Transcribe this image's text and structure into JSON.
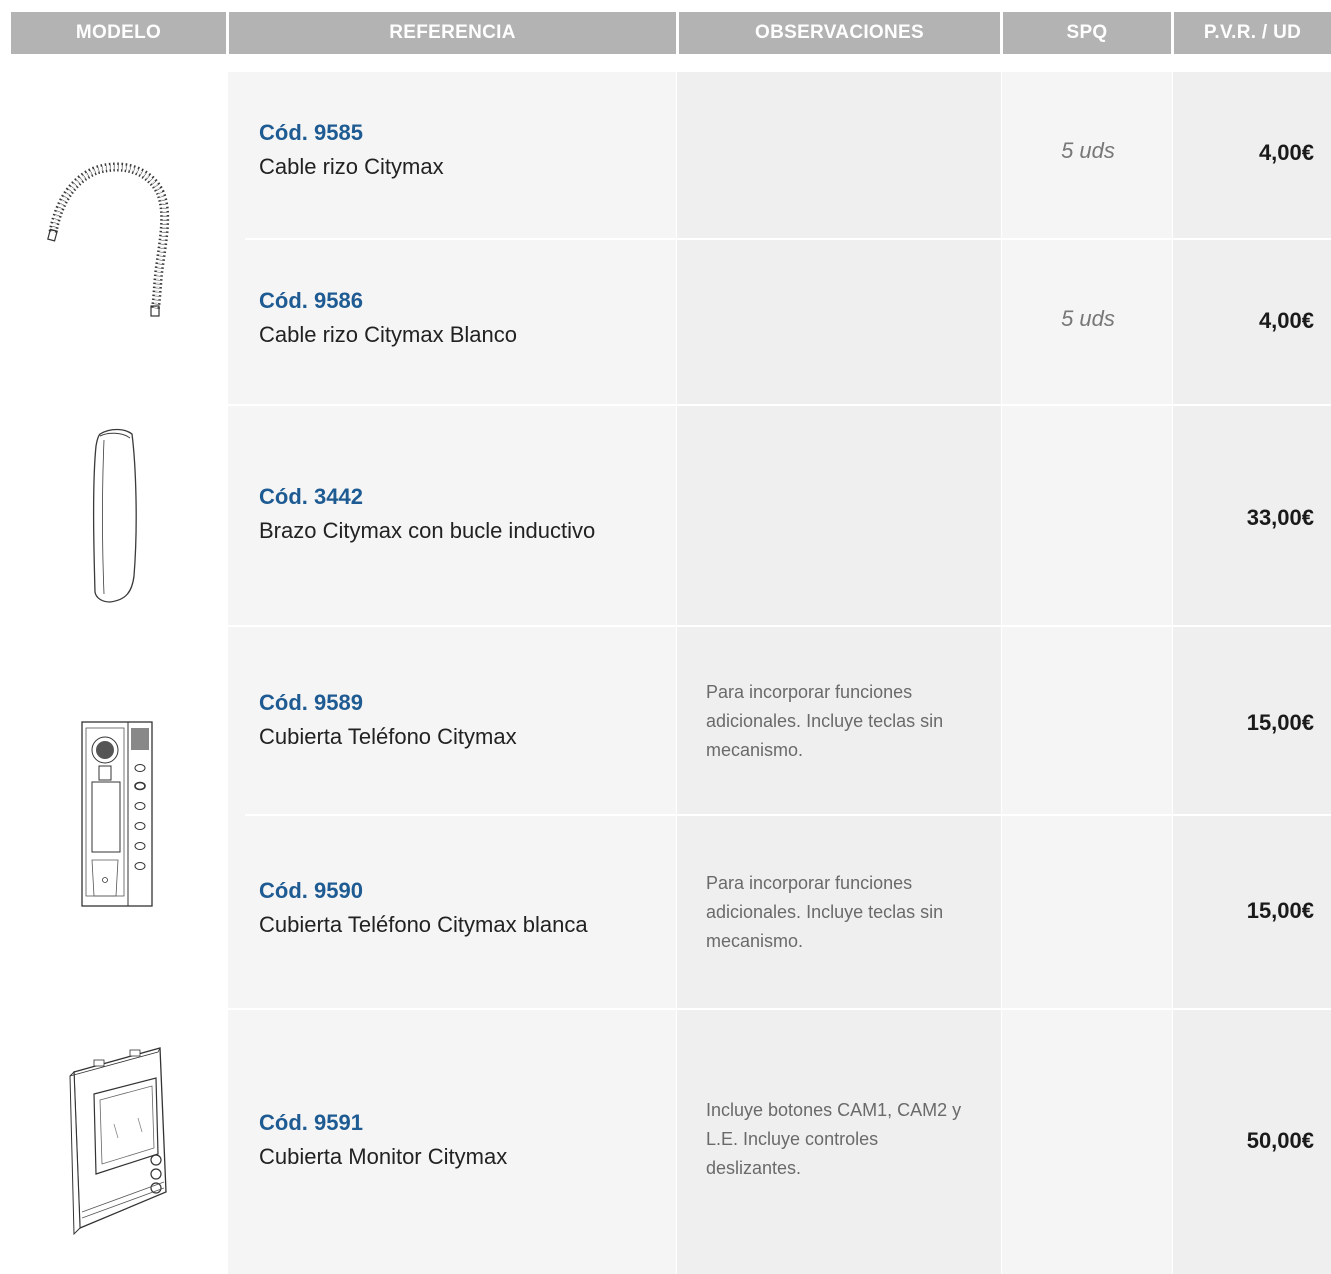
{
  "headers": {
    "modelo": "MODELO",
    "referencia": "REFERENCIA",
    "observaciones": "OBSERVACIONES",
    "spq": "SPQ",
    "pvr": "P.V.R. / UD"
  },
  "rows": [
    {
      "code": "Cód. 9585",
      "desc": "Cable rizo Citymax",
      "obs": "",
      "spq": "5 uds",
      "price": "4,00€"
    },
    {
      "code": "Cód. 9586",
      "desc": "Cable rizo Citymax Blanco",
      "obs": "",
      "spq": "5 uds",
      "price": "4,00€"
    },
    {
      "code": "Cód. 3442",
      "desc": "Brazo Citymax con bucle inductivo",
      "obs": "",
      "spq": "",
      "price": "33,00€"
    },
    {
      "code": "Cód. 9589",
      "desc": "Cubierta Teléfono Citymax",
      "obs": "Para incorporar funciones adicionales. Incluye teclas sin mecanismo.",
      "spq": "",
      "price": "15,00€"
    },
    {
      "code": "Cód. 9590",
      "desc": "Cubierta Teléfono Citymax blanca",
      "obs": "Para incorporar funciones adicionales. Incluye teclas sin mecanismo.",
      "spq": "",
      "price": "15,00€"
    },
    {
      "code": "Cód. 9591",
      "desc": "Cubierta Monitor Citymax",
      "obs": "Incluye botones CAM1, CAM2 y L.E. Incluye controles deslizantes.",
      "spq": "",
      "price": "50,00€"
    }
  ],
  "images": {
    "cable": "coiled-cable-icon",
    "handset": "handset-icon",
    "phone_cover": "phone-cover-icon",
    "monitor_cover": "monitor-cover-icon"
  },
  "colors": {
    "header_bg": "#b3b3b3",
    "code_blue": "#1f5b93",
    "ref_col_bg": "#f5f5f5",
    "obs_col_bg": "#efefef"
  }
}
